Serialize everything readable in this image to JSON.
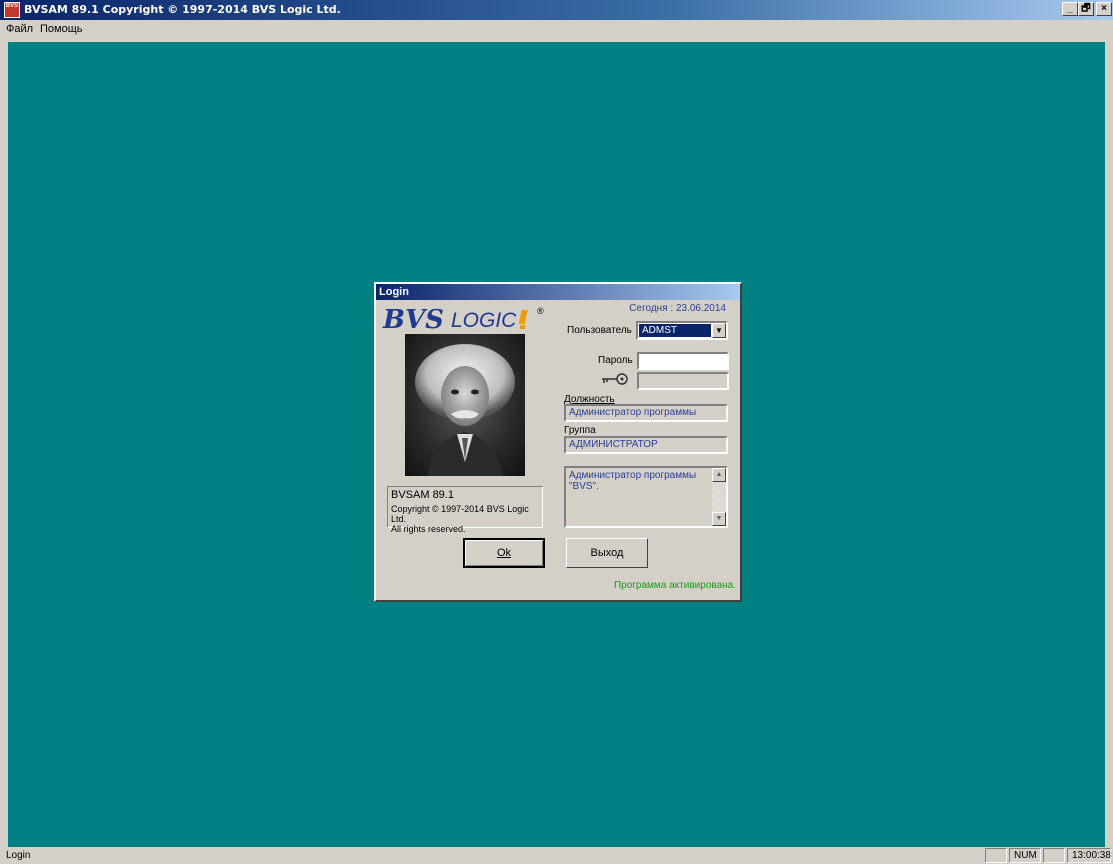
{
  "window": {
    "title": "BVSAM 89.1  Copyright © 1997-2014 BVS Logic Ltd.",
    "icon_text": "BVS",
    "minimize": "_",
    "restore": "🗗",
    "close": "×"
  },
  "menu": [
    "Файл",
    "Помощь"
  ],
  "dialog": {
    "title": "Login",
    "logo": {
      "bvs": "BVS",
      "logic": "LOGIC",
      "reg": "®"
    },
    "today": "Сегодня : 23.06.2014",
    "user_label": "Пользователь",
    "user_value": "ADMST",
    "password_label": "Пароль",
    "password_value": "",
    "key_field_value": "",
    "position_label": "Должность",
    "position_value": "Администратор программы",
    "group_label": "Группа",
    "group_value": "АДМИНИСТРАТОР",
    "description": "Администратор программы \"BVS\".",
    "version": "BVSAM 89.1",
    "copyright": "Copyright © 1997-2014 BVS Logic Ltd.",
    "rights": "All rights reserved.",
    "ok_button": "Ok",
    "exit_button": "Выход",
    "activation_status": "Программа активирована."
  },
  "status_bar": {
    "text": "Login",
    "num": "NUM",
    "time": "13:00:38"
  },
  "colors": {
    "desktop": "#008080",
    "title_active": "#0a246a",
    "field_text": "#2a3f9a",
    "activated": "#1a9a1a"
  }
}
